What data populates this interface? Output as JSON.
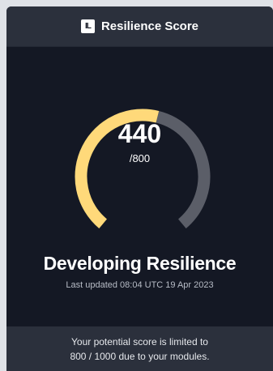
{
  "header": {
    "logo_text": "IL",
    "title": "Resilience Score"
  },
  "gauge": {
    "score": "440",
    "max_label": "/800",
    "score_value": 440,
    "max_value": 800,
    "fill_color": "#ffd97a",
    "track_color": "#5b5e68"
  },
  "status": {
    "level": "Developing Resilience",
    "updated": "Last updated 08:04 UTC 19 Apr 2023"
  },
  "footer": {
    "line1": "Your potential score is limited to",
    "line2": "800 / 1000 due to your modules."
  },
  "colors": {
    "card_bg": "#141824",
    "panel_bg": "#2b303c"
  }
}
